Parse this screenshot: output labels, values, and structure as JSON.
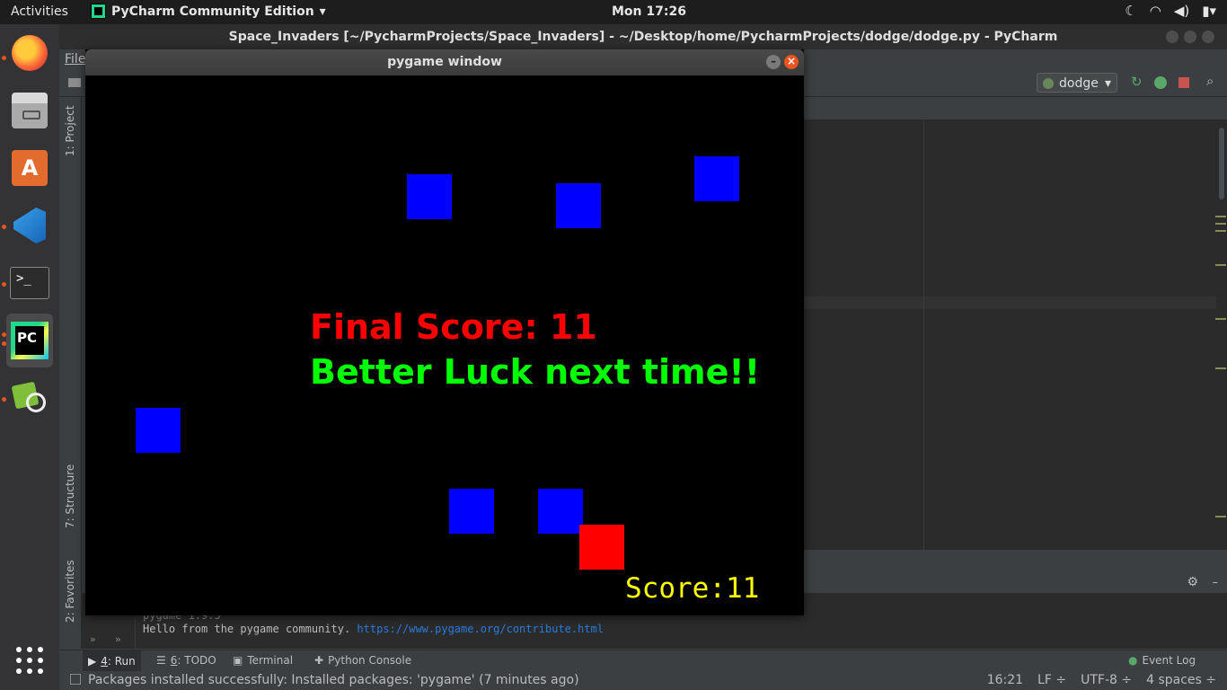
{
  "top_bar": {
    "activities": "Activities",
    "app_menu": "PyCharm Community Edition",
    "clock": "Mon 17:26",
    "tray": [
      "moon-icon",
      "wifi-icon",
      "volume-icon",
      "battery-icon"
    ]
  },
  "dock": {
    "apps": [
      "Firefox",
      "Files",
      "Ubuntu Software",
      "Visual Studio Code",
      "Terminal",
      "PyCharm",
      "Image Viewer",
      "Show Applications"
    ]
  },
  "pycharm": {
    "title": "Space_Invaders [~/PycharmProjects/Space_Invaders] - ~/Desktop/home/PycharmProjects/dodge/dodge.py - PyCharm",
    "menu_file": "File",
    "run_config": "dodge",
    "left_tabs": {
      "project": "1: Project",
      "structure": "7: Structure",
      "favorites": "2: Favorites"
    },
    "console": {
      "line1": "pygame 1.9.5",
      "line2_text": "Hello from the pygame community.",
      "line2_link": "https://www.pygame.org/contribute.html"
    },
    "tool_tabs": {
      "run_num": "4",
      "run": ": Run",
      "todo_num": "6",
      "todo": ": TODO",
      "terminal": "Terminal",
      "python_console": "Python Console",
      "event_log": "Event Log"
    },
    "status": {
      "message": "Packages installed successfully: Installed packages: 'pygame' (7 minutes ago)",
      "position": "16:21",
      "line_sep": "LF ÷",
      "encoding": "UTF-8 ÷",
      "indent": "4 spaces ÷"
    }
  },
  "pygame": {
    "title": "pygame window",
    "final_score": "Final Score: 11",
    "message": "Better Luck next time!!",
    "score": "Score:11",
    "colors": {
      "enemy": "#0000ff",
      "player": "#ff0000",
      "final_text": "#ff0000",
      "message_text": "#00ff00",
      "score_text": "#ffff00",
      "background": "#000000"
    }
  }
}
